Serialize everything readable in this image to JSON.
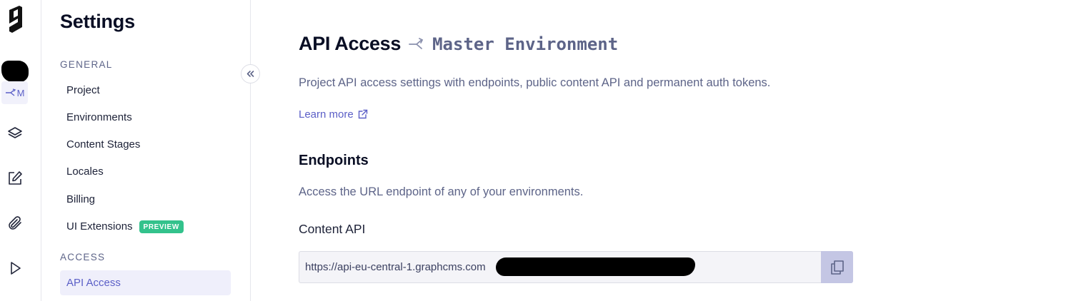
{
  "rail": {
    "env_chip_label": "M",
    "icons": [
      "hygraph-logo-icon",
      "schema-layers-icon",
      "content-edit-icon",
      "assets-paperclip-icon",
      "api-playground-play-icon"
    ]
  },
  "sidebar": {
    "title": "Settings",
    "general_label": "GENERAL",
    "access_label": "ACCESS",
    "items": [
      {
        "label": "Project"
      },
      {
        "label": "Environments"
      },
      {
        "label": "Content Stages"
      },
      {
        "label": "Locales"
      },
      {
        "label": "Billing"
      },
      {
        "label": "UI Extensions",
        "badge": "PREVIEW"
      }
    ],
    "access_items": [
      {
        "label": "API Access",
        "active": true
      }
    ]
  },
  "main": {
    "title": "API Access",
    "environment": "Master Environment",
    "description": "Project API access settings with endpoints, public content API and permanent auth tokens.",
    "learn_more": "Learn more",
    "endpoints_heading": "Endpoints",
    "endpoints_description": "Access the URL endpoint of any of your environments.",
    "content_api_label": "Content API",
    "content_api_url": "https://api-eu-central-1.graphcms.com"
  },
  "colors": {
    "accent": "#5b5fc7",
    "badge": "#33c28c",
    "muted_text": "#5d6488",
    "copy_button": "#c4c6e4"
  }
}
